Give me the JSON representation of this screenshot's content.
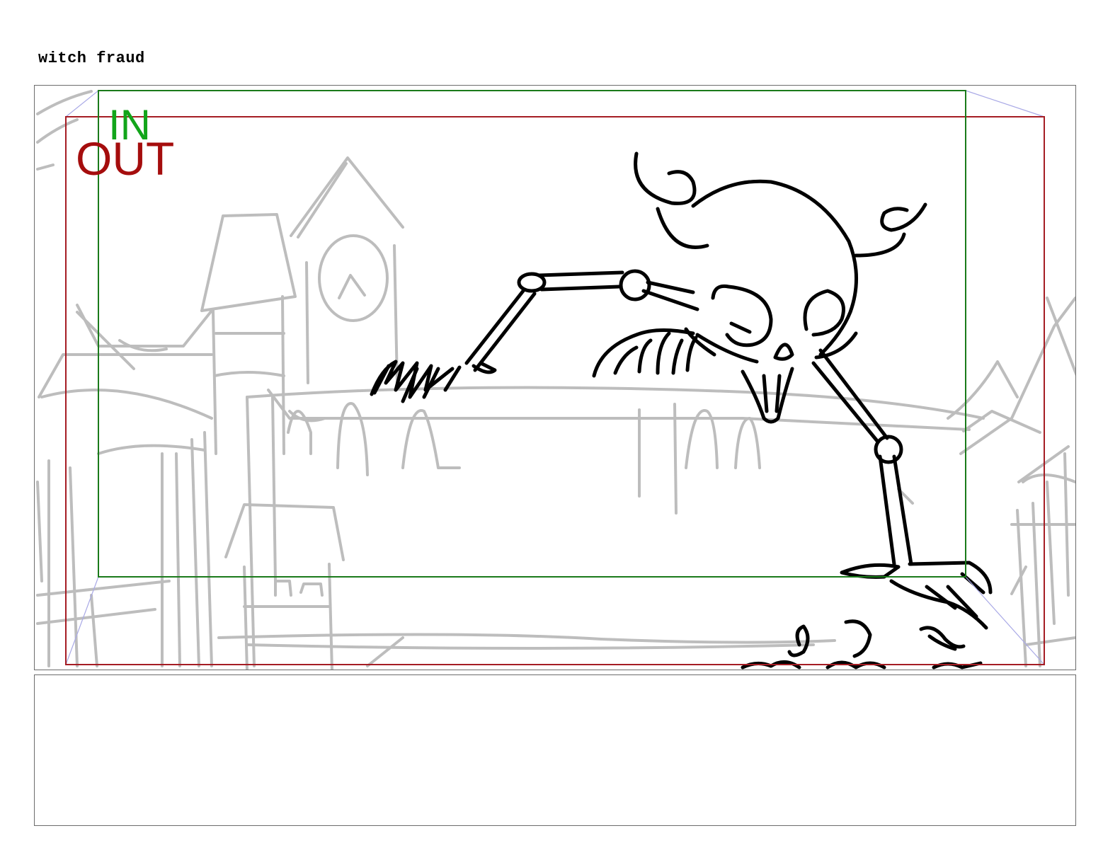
{
  "scene": {
    "title": "witch fraud"
  },
  "panel": {
    "in_label": "IN",
    "out_label": "OUT",
    "in_frame_color": "#1a7a1a",
    "out_frame_color": "#a51d24",
    "camera_move_guide_color": "#a9a9e6",
    "sketch_line_color": "#bdbdbd",
    "ink_line_color": "#000000",
    "content": "rough pencil sketch of a town square with a clock tower and buildings; a large horned skeleton creature in ink reaching over a wall"
  },
  "notes": {
    "text": ""
  }
}
